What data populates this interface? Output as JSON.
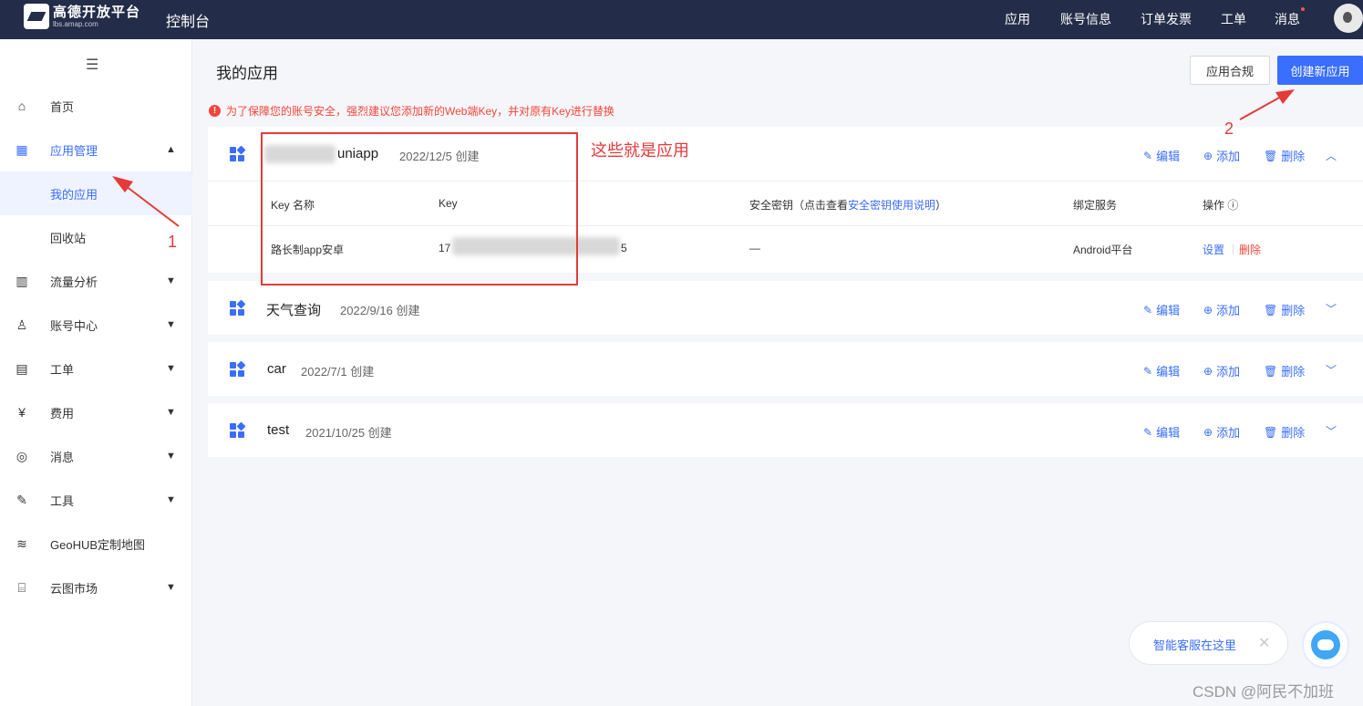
{
  "topbar": {
    "logo_title": "高德开放平台",
    "logo_sub": "lbs.amap.com",
    "console": "控制台",
    "nav": [
      "应用",
      "账号信息",
      "订单发票",
      "工单",
      "消息"
    ]
  },
  "sidebar": {
    "items": [
      {
        "label": "首页",
        "icon": "home-icon"
      },
      {
        "label": "应用管理",
        "icon": "grid-icon"
      },
      {
        "label": "我的应用"
      },
      {
        "label": "回收站"
      },
      {
        "label": "流量分析",
        "icon": "chart-icon"
      },
      {
        "label": "账号中心",
        "icon": "user-icon"
      },
      {
        "label": "工单",
        "icon": "ticket-icon"
      },
      {
        "label": "费用",
        "icon": "yen-icon"
      },
      {
        "label": "消息",
        "icon": "message-icon"
      },
      {
        "label": "工具",
        "icon": "wrench-icon"
      },
      {
        "label": "GeoHUB定制地图",
        "icon": "layers-icon"
      },
      {
        "label": "云图市场",
        "icon": "store-icon"
      }
    ]
  },
  "main": {
    "title": "我的应用",
    "btn_compliance": "应用合规",
    "btn_create": "创建新应用",
    "warning": "为了保障您的账号安全，强烈建议您添加新的Web端Key，并对原有Key进行替换",
    "actions": {
      "edit": "编辑",
      "add": "添加",
      "delete": "删除"
    },
    "apps": [
      {
        "name": "uniapp",
        "date": "2022/12/5 创建"
      },
      {
        "name": "天气查询",
        "date": "2022/9/16 创建"
      },
      {
        "name": "car",
        "date": "2022/7/1 创建"
      },
      {
        "name": "test",
        "date": "2021/10/25 创建"
      }
    ],
    "key_table": {
      "headers": {
        "name": "Key 名称",
        "key": "Key",
        "secret_prefix": "安全密钥（点击查看",
        "secret_link": "安全密钥使用说明",
        "secret_suffix": "）",
        "service": "绑定服务",
        "ops": "操作 ⓘ"
      },
      "row": {
        "name": "路长制app安卓",
        "key_start": "17",
        "key_end": "5",
        "secret": "—",
        "service": "Android平台",
        "settings": "设置",
        "delete": "删除"
      }
    }
  },
  "annotations": {
    "box_text": "这些就是应用",
    "num1": "1",
    "num2": "2"
  },
  "chat": {
    "label": "智能客服在这里",
    "close": "✕"
  },
  "watermark": "CSDN @阿民不加班",
  "colors": {
    "accent": "#3a6eff",
    "topbar": "#232c48",
    "danger": "#f5453a",
    "annotation": "#e43a3a"
  }
}
